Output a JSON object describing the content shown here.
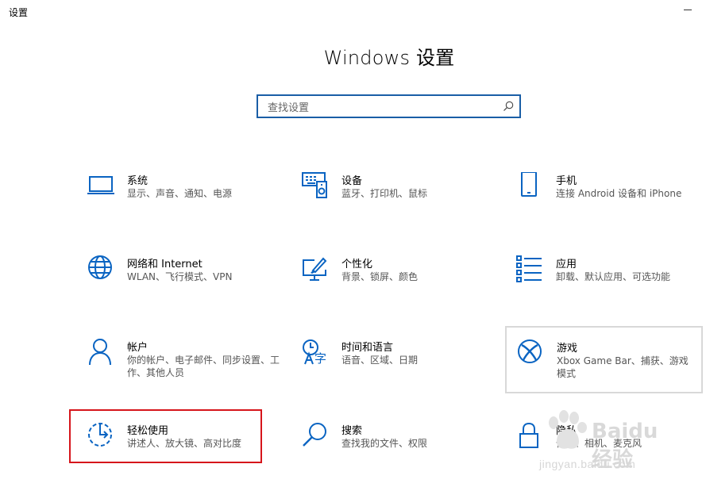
{
  "window": {
    "title": "设置"
  },
  "heading": "Windows 设置",
  "search": {
    "placeholder": "查找设置"
  },
  "tiles": [
    {
      "name": "系统",
      "desc": "显示、声音、通知、电源",
      "icon": "laptop-icon"
    },
    {
      "name": "设备",
      "desc": "蓝牙、打印机、鼠标",
      "icon": "devices-icon"
    },
    {
      "name": "手机",
      "desc": "连接 Android 设备和 iPhone",
      "icon": "phone-icon"
    },
    {
      "name": "网络和 Internet",
      "desc": "WLAN、飞行模式、VPN",
      "icon": "globe-icon"
    },
    {
      "name": "个性化",
      "desc": "背景、锁屏、颜色",
      "icon": "personalization-icon"
    },
    {
      "name": "应用",
      "desc": "卸载、默认应用、可选功能",
      "icon": "apps-list-icon"
    },
    {
      "name": "帐户",
      "desc": "你的帐户、电子邮件、同步设置、工作、其他人员",
      "icon": "person-icon"
    },
    {
      "name": "时间和语言",
      "desc": "语音、区域、日期",
      "icon": "time-language-icon"
    },
    {
      "name": "游戏",
      "desc": "Xbox Game Bar、捕获、游戏模式",
      "icon": "xbox-icon"
    },
    {
      "name": "轻松使用",
      "desc": "讲述人、放大镜、高对比度",
      "icon": "ease-of-access-icon"
    },
    {
      "name": "搜索",
      "desc": "查找我的文件、权限",
      "icon": "search-icon"
    },
    {
      "name": "隐私",
      "desc": "位置、相机、麦克风",
      "icon": "lock-icon"
    }
  ],
  "watermark": {
    "brand": "Baidu 经验",
    "url": "jingyan.baidu.com"
  },
  "colors": {
    "accent": "#0a64c2",
    "highlight": "#d6151b"
  }
}
